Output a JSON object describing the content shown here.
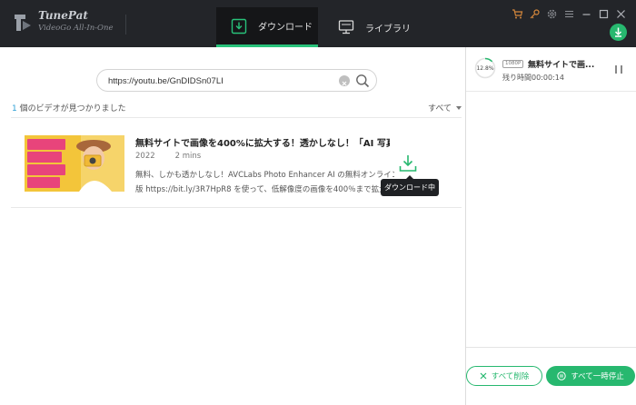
{
  "app": {
    "name": "TunePat",
    "subtitle": "VideoGo All-In-One"
  },
  "tabs": [
    {
      "label": "ダウンロード",
      "icon": "download-tab-icon",
      "active": true
    },
    {
      "label": "ライブラリ",
      "icon": "monitor-icon",
      "active": false
    }
  ],
  "titlebar_icons": [
    "cart-icon",
    "key-icon",
    "settings-icon",
    "menu-icon",
    "minimize-icon",
    "maximize-icon",
    "close-icon"
  ],
  "search": {
    "value": "https://youtu.be/GnDIDSn07LI"
  },
  "results": {
    "count": "1",
    "count_suffix": " 個のビデオが見つかりました",
    "sort_label": "すべて"
  },
  "video": {
    "title": "無料サイトで画像を400%に拡大する！透かしなし！「AI 写真...",
    "year": "2022",
    "duration": "2 mins",
    "desc_line1": "無料、しかも透かしなし！AVCLabs Photo Enhancer AI の無料オンライン",
    "desc_line2": "版 https://bit.ly/3R7HpR8 を使って、低解像度の画像を400％まで拡大で...",
    "tooltip": "ダウンロード中"
  },
  "queue": {
    "progress": "12.8%",
    "progress_fraction": 0.128,
    "quality": "1080P",
    "title": "無料サイトで画...",
    "remaining": "残り時間00:00:14"
  },
  "buttons": {
    "delete_all": "すべて削除",
    "pause_all": "すべて一時停止"
  },
  "colors": {
    "accent": "#27b86f",
    "titlebar": "#232529",
    "toolbar_icon": "#d4873b"
  }
}
